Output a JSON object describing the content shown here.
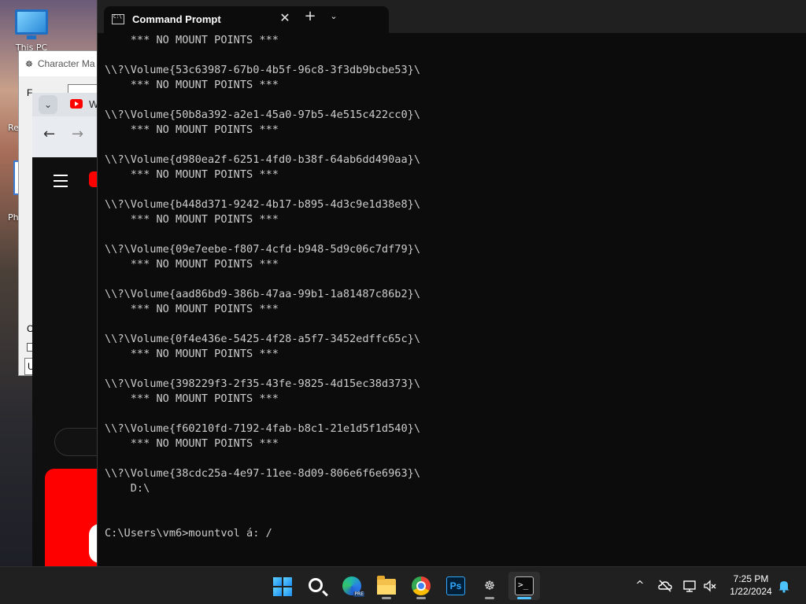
{
  "desktop": {
    "icons": [
      {
        "label": "This PC"
      },
      {
        "label": "Re"
      },
      {
        "label": "Ph"
      }
    ]
  },
  "character_map": {
    "title": "Character Ma",
    "font_label": "F",
    "char_label": "C",
    "combo_value": "U"
  },
  "browser": {
    "tab_title": "W",
    "back_icon": "back-arrow-icon",
    "forward_icon": "forward-arrow-icon"
  },
  "terminal": {
    "tab_title": "Command Prompt",
    "close_glyph": "✕",
    "new_tab_glyph": "+",
    "dropdown_glyph": "⌄",
    "lines": [
      "    *** NO MOUNT POINTS ***",
      "",
      "\\\\?\\Volume{53c63987-67b0-4b5f-96c8-3f3db9bcbe53}\\",
      "    *** NO MOUNT POINTS ***",
      "",
      "\\\\?\\Volume{50b8a392-a2e1-45a0-97b5-4e515c422cc0}\\",
      "    *** NO MOUNT POINTS ***",
      "",
      "\\\\?\\Volume{d980ea2f-6251-4fd0-b38f-64ab6dd490aa}\\",
      "    *** NO MOUNT POINTS ***",
      "",
      "\\\\?\\Volume{b448d371-9242-4b17-b895-4d3c9e1d38e8}\\",
      "    *** NO MOUNT POINTS ***",
      "",
      "\\\\?\\Volume{09e7eebe-f807-4cfd-b948-5d9c06c7df79}\\",
      "    *** NO MOUNT POINTS ***",
      "",
      "\\\\?\\Volume{aad86bd9-386b-47aa-99b1-1a81487c86b2}\\",
      "    *** NO MOUNT POINTS ***",
      "",
      "\\\\?\\Volume{0f4e436e-5425-4f28-a5f7-3452edffc65c}\\",
      "    *** NO MOUNT POINTS ***",
      "",
      "\\\\?\\Volume{398229f3-2f35-43fe-9825-4d15ec38d373}\\",
      "    *** NO MOUNT POINTS ***",
      "",
      "\\\\?\\Volume{f60210fd-7192-4fab-b8c1-21e1d5f1d540}\\",
      "    *** NO MOUNT POINTS ***",
      "",
      "\\\\?\\Volume{38cdc25a-4e97-11ee-8d09-806e6f6e6963}\\",
      "    D:\\",
      "",
      "",
      "C:\\Users\\vm6>mountvol á: /"
    ],
    "colors": {
      "background": "#0c0c0c",
      "text": "#cccccc"
    }
  },
  "taskbar": {
    "apps": [
      {
        "name": "start",
        "icon": "windows-logo-icon"
      },
      {
        "name": "search",
        "icon": "search-icon"
      },
      {
        "name": "edge",
        "icon": "edge-beta-icon"
      },
      {
        "name": "file-explorer",
        "icon": "folder-icon"
      },
      {
        "name": "chrome",
        "icon": "chrome-icon"
      },
      {
        "name": "photoshop",
        "icon": "photoshop-icon",
        "label": "Ps"
      },
      {
        "name": "character-map",
        "icon": "character-map-icon"
      },
      {
        "name": "terminal",
        "icon": "terminal-icon",
        "label": ">_"
      }
    ],
    "tray": {
      "chevron": "^",
      "time": "7:25 PM",
      "date": "1/22/2024"
    },
    "accent": "#4cc2ff"
  }
}
